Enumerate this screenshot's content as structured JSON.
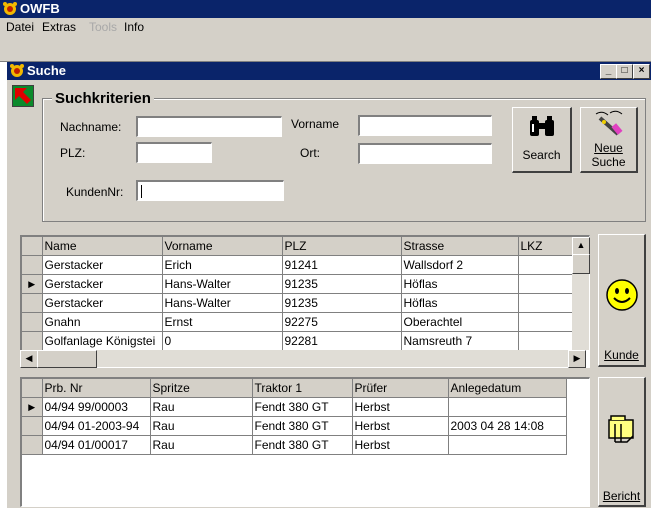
{
  "app": {
    "title": "OWFB"
  },
  "menu": {
    "items": [
      "Datei",
      "Extras",
      "Tools",
      "Info"
    ],
    "disabled": [
      "Tools"
    ]
  },
  "window": {
    "title": "Suche"
  },
  "search": {
    "legend": "Suchkriterien",
    "nachname_label": "Nachname:",
    "vorname_label": "Vorname",
    "plz_label": "PLZ:",
    "ort_label": "Ort:",
    "kundennr_label": "KundenNr:",
    "nachname_value": "",
    "vorname_value": "",
    "plz_value": "",
    "ort_value": "",
    "kundennr_value": "",
    "search_button": "Search",
    "new_search_button_line1": "Neue",
    "new_search_button_line2": "Suche"
  },
  "customers": {
    "columns": [
      "Name",
      "Vorname",
      "PLZ",
      "Strasse",
      "LKZ"
    ],
    "rows": [
      {
        "name": "Gerstacker",
        "vorname": "Erich",
        "plz": "91241",
        "strasse": "Wallsdorf 2",
        "lkz": "",
        "current": false
      },
      {
        "name": "Gerstacker",
        "vorname": "Hans-Walter",
        "plz": "91235",
        "strasse": "Höflas",
        "lkz": "",
        "current": true
      },
      {
        "name": "Gerstacker",
        "vorname": "Hans-Walter",
        "plz": "91235",
        "strasse": "Höflas",
        "lkz": "",
        "current": false
      },
      {
        "name": "Gnahn",
        "vorname": "Ernst",
        "plz": "92275",
        "strasse": "Oberachtel",
        "lkz": "",
        "current": false
      },
      {
        "name": "Golfanlage Königstei",
        "vorname": "0",
        "plz": "92281",
        "strasse": "Namsreuth 7",
        "lkz": "",
        "current": false
      }
    ],
    "kunde_button": "Kunde"
  },
  "reports": {
    "columns": [
      "Prb. Nr",
      "Spritze",
      "Traktor 1",
      "Prüfer",
      "Anlegedatum"
    ],
    "rows": [
      {
        "prb_nr": "04/94 99/00003",
        "spritze": "Rau",
        "traktor": "Fendt 380 GT",
        "pruefer": "Herbst",
        "datum": "",
        "current": true
      },
      {
        "prb_nr": "04/94 01-2003-94",
        "spritze": "Rau",
        "traktor": "Fendt 380 GT",
        "pruefer": "Herbst",
        "datum": "2003 04 28 14:08",
        "current": false
      },
      {
        "prb_nr": "04/94 01/00017",
        "spritze": "Rau",
        "traktor": "Fendt 380 GT",
        "pruefer": "Herbst",
        "datum": "",
        "current": false
      }
    ],
    "bericht_button": "Bericht"
  },
  "colors": {
    "title_bar": "#0a246a",
    "face": "#d4d0c8",
    "back_button": "#0b8a2c",
    "smiley": "#ffff00"
  }
}
